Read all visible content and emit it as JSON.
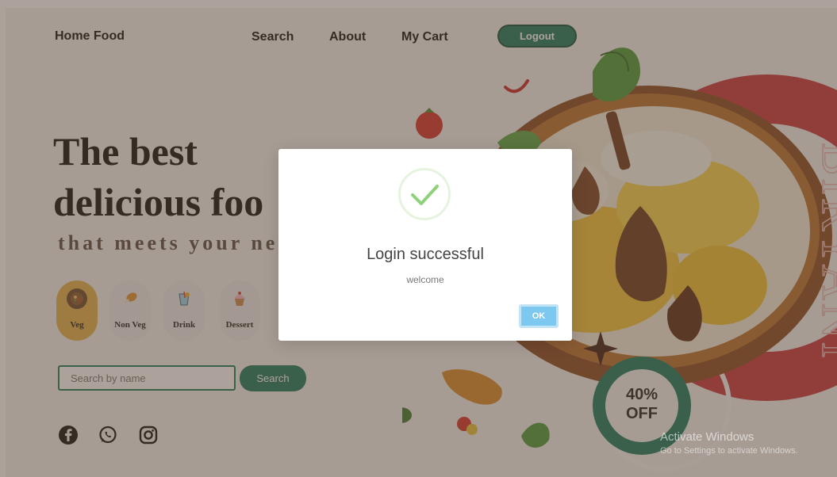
{
  "nav": {
    "brand": "Home Food",
    "links": [
      "Search",
      "About",
      "My Cart"
    ],
    "logout": "Logout"
  },
  "hero": {
    "title_line1": "The best",
    "title_line2": "delicious foo",
    "subtitle": "that meets your nee",
    "side_text": "BIRYANI",
    "badge_line1": "40%",
    "badge_line2": "OFF"
  },
  "categories": [
    {
      "label": "Veg",
      "icon": "bowl-icon",
      "active": true
    },
    {
      "label": "Non Veg",
      "icon": "drumstick-icon",
      "active": false
    },
    {
      "label": "Drink",
      "icon": "drink-icon",
      "active": false
    },
    {
      "label": "Dessert",
      "icon": "cupcake-icon",
      "active": false
    }
  ],
  "search": {
    "placeholder": "Search by name",
    "button": "Search"
  },
  "social": [
    "facebook-icon",
    "whatsapp-icon",
    "instagram-icon"
  ],
  "modal": {
    "title": "Login successful",
    "text": "welcome",
    "ok": "OK"
  },
  "watermark": {
    "line1": "Activate Windows",
    "line2": "Go to Settings to activate Windows."
  },
  "colors": {
    "accent": "#1b7a5e",
    "category_active": "#e2b04b",
    "ring": "#c8363f",
    "ok_button": "#7dc8ee"
  }
}
